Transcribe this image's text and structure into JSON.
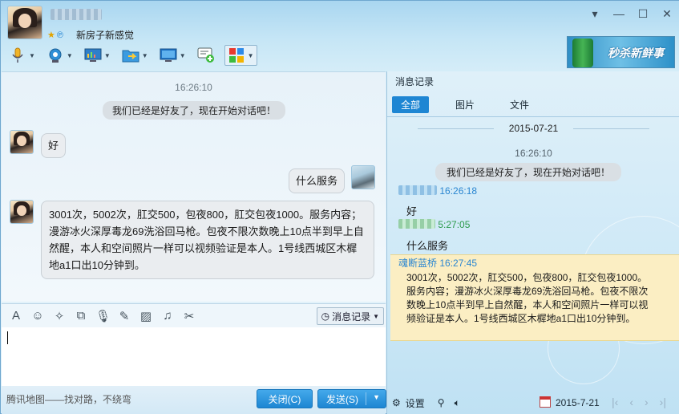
{
  "header": {
    "signature": "新房子新感觉",
    "window_buttons": [
      "▾",
      "—",
      "☐",
      "✕"
    ]
  },
  "toolbar": {
    "items": [
      {
        "name": "voice",
        "icon": "microphone-icon"
      },
      {
        "name": "video",
        "icon": "camera-icon"
      },
      {
        "name": "remote",
        "icon": "screen-share-icon"
      },
      {
        "name": "file",
        "icon": "folder-transfer-icon"
      },
      {
        "name": "remote-desktop",
        "icon": "monitor-icon"
      },
      {
        "name": "group-chat",
        "icon": "add-chat-icon"
      },
      {
        "name": "apps",
        "icon": "apps-grid-icon"
      }
    ]
  },
  "ad": {
    "text": "秒杀新鲜事"
  },
  "chat": {
    "time": "16:26:10",
    "system_msg": "我们已经是好友了，现在开始对话吧！",
    "msg1": "好",
    "msg2": "什么服务",
    "msg3": "3001次，5002次，肛交500，包夜800，肛交包夜1000。服务内容；漫游冰火深厚毒龙69洗浴回马枪。包夜不限次数晚上10点半到早上自然醒，本人和空间照片一样可以视频验证是本人。1号线西城区木樨地a1口出10分钟到。"
  },
  "input_toolbar": {
    "icons": [
      "font-icon",
      "emoji-icon",
      "nudge-icon",
      "screenshot-icon",
      "voice-message-icon",
      "edit-icon",
      "image-icon",
      "music-icon",
      "scissors-icon"
    ],
    "history_label": "消息记录"
  },
  "bottom": {
    "map_link": "腾讯地图——找对路，不绕弯",
    "close_label": "关闭(C)",
    "send_label": "发送(S)"
  },
  "history": {
    "title": "消息记录",
    "tabs": [
      "全部",
      "图片",
      "文件"
    ],
    "date": "2015-07-21",
    "time": "16:26:10",
    "system_msg": "我们已经是好友了，现在开始对话吧！",
    "entry1_time": "16:26:18",
    "entry1_msg": "好",
    "entry2_time": "5:27:05",
    "entry2_msg": "什么服务",
    "entry3_sender": "魂断蓝桥",
    "entry3_time": "16:27:45",
    "entry3_msg": "3001次，5002次，肛交500，包夜800，肛交包夜1000。服务内容；漫游冰火深厚毒龙69洗浴回马枪。包夜不限次数晚上10点半到早上自然醒，本人和空间照片一样可以视频验证是本人。1号线西城区木樨地a1口出10分钟到。",
    "settings_label": "设置",
    "footer_date": "2015-7-21"
  }
}
